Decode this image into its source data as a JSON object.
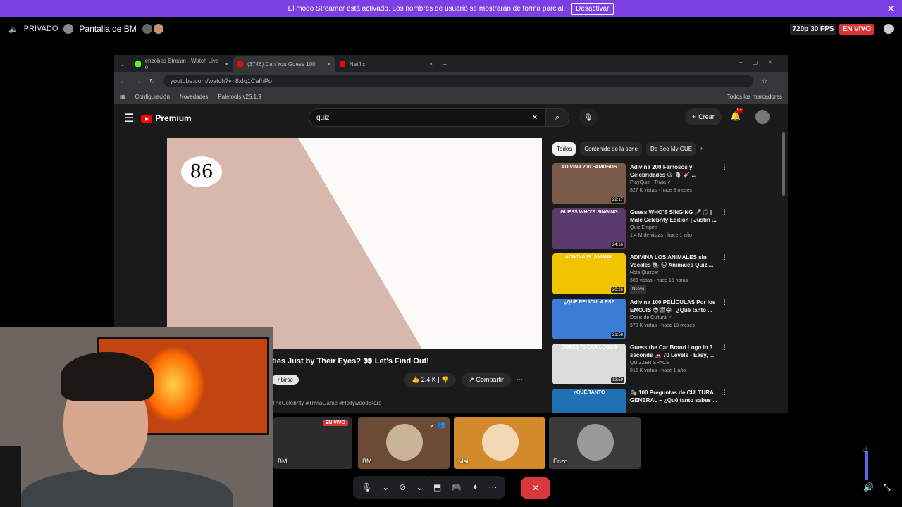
{
  "banner": {
    "text": "El modo Streamer está activado. Los nombres de usuario se mostrarán de forma parcial.",
    "button": "Desactivar",
    "close": "✕"
  },
  "topbar": {
    "privacy": "PRIVADO",
    "screen": "Pantalla de BM",
    "quality": "720p 30 FPS",
    "live": "EN VIVO"
  },
  "browser": {
    "tabs": [
      {
        "label": "enzobes Stream - Watch Live o",
        "color": "#53fc18"
      },
      {
        "label": "(3746) Can You Guess 100",
        "color": "#ff0000"
      },
      {
        "label": "Netflix",
        "color": "#e50914"
      }
    ],
    "url": "youtube.com/watch?v=8xIq1CafhPo",
    "bookmarks": [
      "Configuración",
      "Novedades",
      "Paletools v25.1.9"
    ],
    "bookmarks_right": "Todos los marcadores"
  },
  "youtube": {
    "logo": "Premium",
    "search": "quiz",
    "crear": "Crear",
    "notif_badge": "9+",
    "player_number": "86",
    "video_title": "ties Just by Their Eyes? 👀 Let's Find Out!",
    "subscribe": "ribirse",
    "likes": "2.4 K",
    "share": "Compartir",
    "tags": "TheCelebrity #TriviaGame #HollywoodStars",
    "chips": [
      "Todos",
      "Contenido de la serie",
      "De Bee My GUE"
    ],
    "related": [
      {
        "thumb": "ADIVINA 200 FAMOSOS",
        "bg": "#7a5a4a",
        "dur": "22:17",
        "title": "Adivina 200 Famosos y Celebridades 😃 🎙 🎸 ...",
        "channel": "PlayQuiz - Trivia ✓",
        "meta": "827 K vistas · hace 3 meses",
        "nuevo": ""
      },
      {
        "thumb": "GUESS WHO'S SINGING",
        "bg": "#5a3b6b",
        "dur": "24:16",
        "title": "Guess WHO'S SINGING 🎤🎵 | Male Celebrity Edition | Justin ...",
        "channel": "Quiz Empire",
        "meta": "1.4 M de vistas · hace 1 año",
        "nuevo": ""
      },
      {
        "thumb": "ADIVINA EL ANIMAL",
        "bg": "#f2c300",
        "dur": "20:26",
        "title": "ADIVINA LOS ANIMALES sin Vocales 🐘 🐱 Animales Quiz ...",
        "channel": "Hola Quizzer",
        "meta": "606 vistas · hace 15 horas",
        "nuevo": "Nuevo"
      },
      {
        "thumb": "¿QUÉ PELÍCULA ES?",
        "bg": "#3a7bd5",
        "dur": "21:56",
        "title": "Adivina 100 PELÍCULAS Por los EMOJIS 😎🎬😁 | ¿Qué tanto ...",
        "channel": "Dosis de Cultura ✓",
        "meta": "678 K vistas · hace 10 meses",
        "nuevo": ""
      },
      {
        "thumb": "GUESS 70 CAR LOGOS",
        "bg": "#dcdcdc",
        "dur": "13:59",
        "title": "Guess the Car Brand Logo in 3 seconds 🚗 70 Levels - Easy, ...",
        "channel": "QUIZZER SPACE",
        "meta": "815 K vistas · hace 1 año",
        "nuevo": ""
      },
      {
        "thumb": "¿QUÉ TANTO",
        "bg": "#1f6fb2",
        "dur": "",
        "title": "🎭 100 Preguntas de CULTURA GENERAL – ¿Qué tanto sabes ...",
        "channel": "",
        "meta": "",
        "nuevo": ""
      }
    ]
  },
  "participants": [
    {
      "label": "BM",
      "live": "EN VIVO",
      "bg": "#2c2c2c"
    },
    {
      "label": "BM",
      "live": "",
      "bg": "#6b4b36"
    },
    {
      "label": "Mai",
      "live": "",
      "bg": "#d28a2a"
    },
    {
      "label": "Enzo",
      "live": "",
      "bg": "#3a3a3a"
    }
  ]
}
